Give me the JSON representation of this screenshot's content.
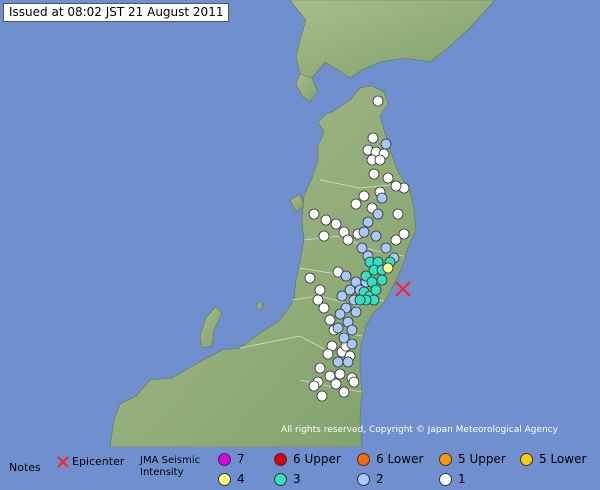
{
  "header": {
    "issued_text": "Issued at 08:02 JST  21 August 2011"
  },
  "copyright": "All rights reserved, Copyright © Japan Meteorological Agency",
  "legend": {
    "notes_label": "Notes",
    "epicenter_label": "Epicenter",
    "scale_label_line1": "JMA Seismic",
    "scale_label_line2": "Intensity",
    "levels": [
      {
        "label": "7",
        "color": "#e000e0"
      },
      {
        "label": "6 Upper",
        "color": "#e00000"
      },
      {
        "label": "6 Lower",
        "color": "#ff6a00"
      },
      {
        "label": "5 Upper",
        "color": "#ff9900"
      },
      {
        "label": "5 Lower",
        "color": "#ffcc00"
      },
      {
        "label": "4",
        "color": "#ffff88"
      },
      {
        "label": "3",
        "color": "#33e0c0"
      },
      {
        "label": "2",
        "color": "#a8c8ff"
      },
      {
        "label": "1",
        "color": "#ffffff"
      }
    ]
  },
  "colors": {
    "sea": "#6f8fcf",
    "land": "#8fb07a",
    "epicenter": "#ff2020"
  }
}
